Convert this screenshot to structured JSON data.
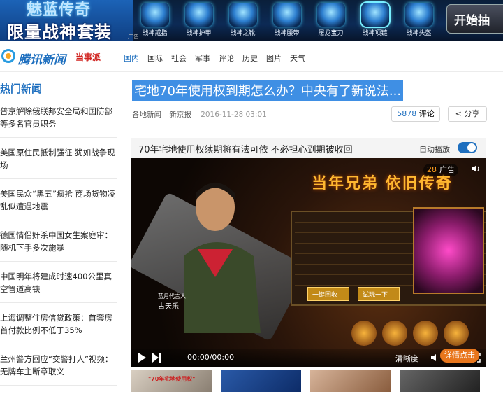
{
  "banner": {
    "title_line1": "魅蓝传奇",
    "title_line2": "限量战神套装",
    "items": [
      "战神戒指",
      "战神护甲",
      "战神之靴",
      "战神腰带",
      "屠龙宝刀",
      "战神项链",
      "战神头盔"
    ],
    "selected_index": 5,
    "start_label": "开始抽",
    "small_note": "广告"
  },
  "nav": {
    "logo_text": "腾讯新闻",
    "logo_sub": "当事派",
    "links": [
      "国内",
      "国际",
      "社会",
      "军事",
      "评论",
      "历史",
      "图片",
      "天气"
    ],
    "active_index": 0
  },
  "sidebar": {
    "title": "热门新闻",
    "items": [
      "普京解除俄联邦安全局和国防部等多名官员职务",
      "美国原住民抵制强征 犹如战争现场",
      "美国民众“黑五”疯抢 商场货物凌乱似遭遇地震",
      "德国情侣奸杀中国女生案庭审：随机下手多次施暴",
      "中国明年将建成时速400公里真空管道高铁",
      "上海调整住房信贷政策：首套房首付款比例不低于35%",
      "兰州警方回应“交警打人”视频：无牌车主断章取义"
    ]
  },
  "article": {
    "headline": "宅地70年使用权到期怎么办？中央有了新说法...",
    "source1": "各地新闻",
    "source2": "新京报",
    "date": "2016-11-28 03:01",
    "comment_count": "5878",
    "comment_label": "评论",
    "share_label": "分享"
  },
  "video": {
    "title": "70年宅地使用权续期将有法可依 不必担心到期被收回",
    "autoplay_label": "自动播放",
    "autoplay_on": true,
    "ad_countdown": "28",
    "ad_label": "广告",
    "ad_headline": "当年兄弟 依旧传奇",
    "ad_signature": "古天乐",
    "ad_signature_sub": "蓝月代言人",
    "detail_label": "详情点击",
    "btn1_label": "一键回收",
    "btn2_label": "试玩一下",
    "time": "00:00/00:00",
    "clarity_label": "清晰度"
  },
  "thumbs": [
    {
      "caption": "\"70年宅地使用权\""
    },
    {
      "caption": ""
    },
    {
      "caption": ""
    },
    {
      "caption": ""
    }
  ]
}
